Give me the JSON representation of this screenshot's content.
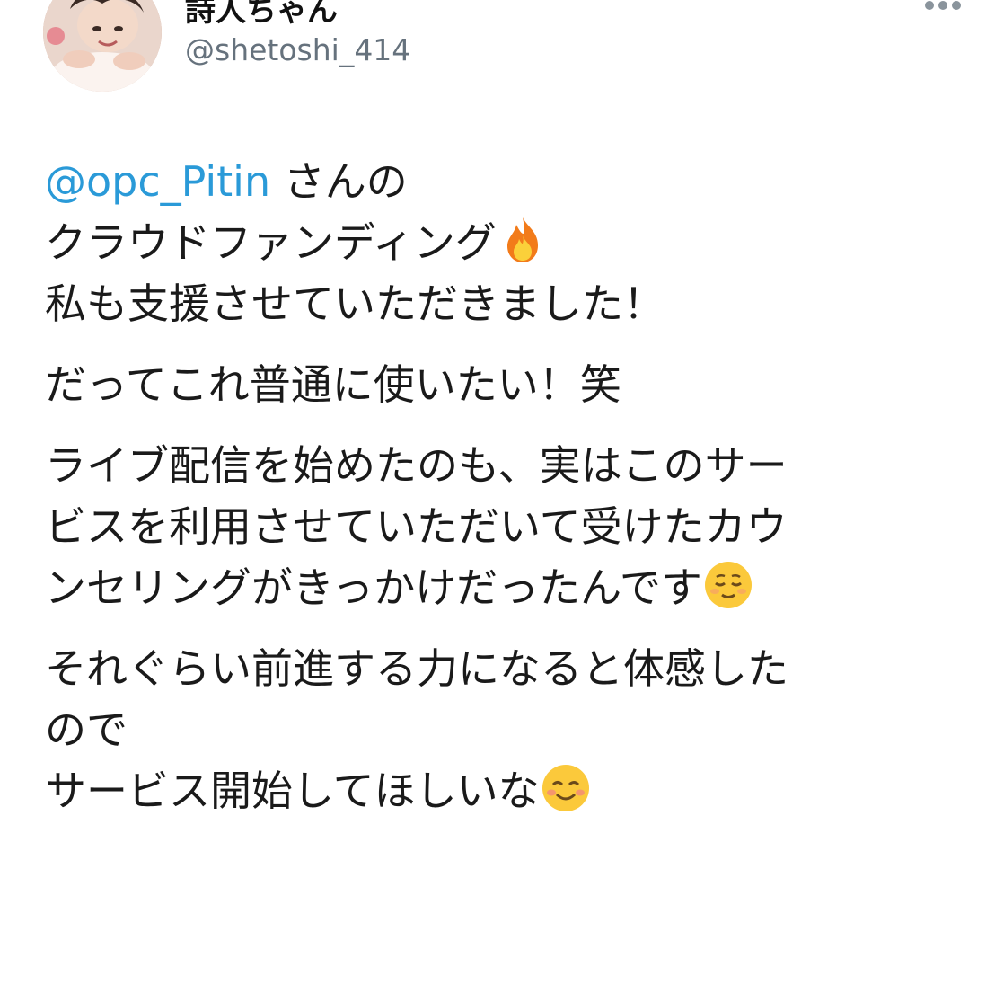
{
  "user": {
    "display_name": "詩人ちゃん",
    "handle": "@shetoshi_414",
    "avatar_icon": "user-avatar-photo"
  },
  "menu": {
    "icon": "more-options-icon"
  },
  "tweet": {
    "mention": "@opc_Pitin",
    "line1_suffix": " さんの",
    "line2": "クラウドファンディング",
    "line2_emoji": "fire-emoji",
    "line3": "私も支援させていただきました！",
    "line4": "だってこれ普通に使いたい！笑",
    "line5": "ライブ配信を始めたのも、実はこのサー",
    "line6": "ビスを利用させていただいて受けたカウ",
    "line7": "ンセリングがきっかけだったんです",
    "line7_emoji": "relieved-face-emoji",
    "line8": "それぐらい前進する力になると体感した",
    "line9": "ので",
    "line10": "サービス開始してほしいな",
    "line10_emoji": "smiling-face-emoji"
  },
  "colors": {
    "mention": "#2a9ad8",
    "handle": "#66727d",
    "text": "#1a1a1a",
    "background": "#ffffff"
  }
}
